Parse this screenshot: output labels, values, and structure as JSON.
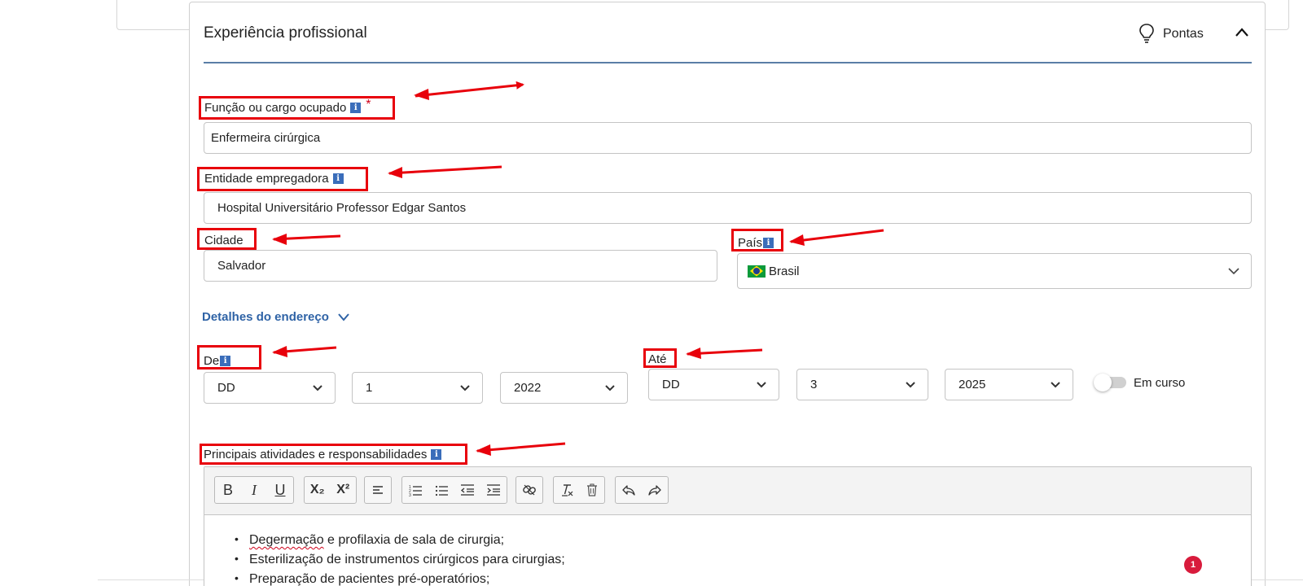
{
  "section": {
    "title": "Experiência profissional",
    "tips_label": "Pontas"
  },
  "job_title": {
    "label": "Função ou cargo ocupado",
    "required_mark": "*",
    "value": "Enfermeira cirúrgica"
  },
  "employer": {
    "label": "Entidade empregadora",
    "value": "Hospital Universitário Professor Edgar Santos"
  },
  "city": {
    "label": "Cidade",
    "value": "Salvador"
  },
  "country": {
    "label": "País",
    "value": "Brasil"
  },
  "address_details_link": "Detalhes do endereço",
  "from": {
    "label": "De",
    "day": "DD",
    "month": "1",
    "year": "2022"
  },
  "to": {
    "label": "Até",
    "day": "DD",
    "month": "3",
    "year": "2025"
  },
  "ongoing_label": "Em curso",
  "activities": {
    "label": "Principais atividades e responsabilidades",
    "items": [
      {
        "misspelled": "Degermação",
        "rest": " e profilaxia de sala de cirurgia;"
      },
      {
        "misspelled": "",
        "rest": "Esterilização de instrumentos cirúrgicos para cirurgias;"
      },
      {
        "misspelled": "",
        "rest": "Preparação de pacientes pré-operatórios;"
      }
    ]
  },
  "toolbar": {
    "bold": "B",
    "italic": "I",
    "underline": "U",
    "subscript": "X₂",
    "superscript": "X²"
  },
  "notification_count": "1",
  "colors": {
    "annotation": "#e8000b",
    "link": "#2f63a6",
    "info_icon": "#3a6dba",
    "rule": "#5a7ea6",
    "badge": "#d81b3c"
  },
  "icons": [
    "lightbulb-icon",
    "chevron-up-icon",
    "info-icon",
    "chevron-down-icon",
    "brazil-flag-icon",
    "link-icon",
    "clear-format-icon",
    "trash-icon",
    "undo-icon",
    "redo-icon"
  ]
}
